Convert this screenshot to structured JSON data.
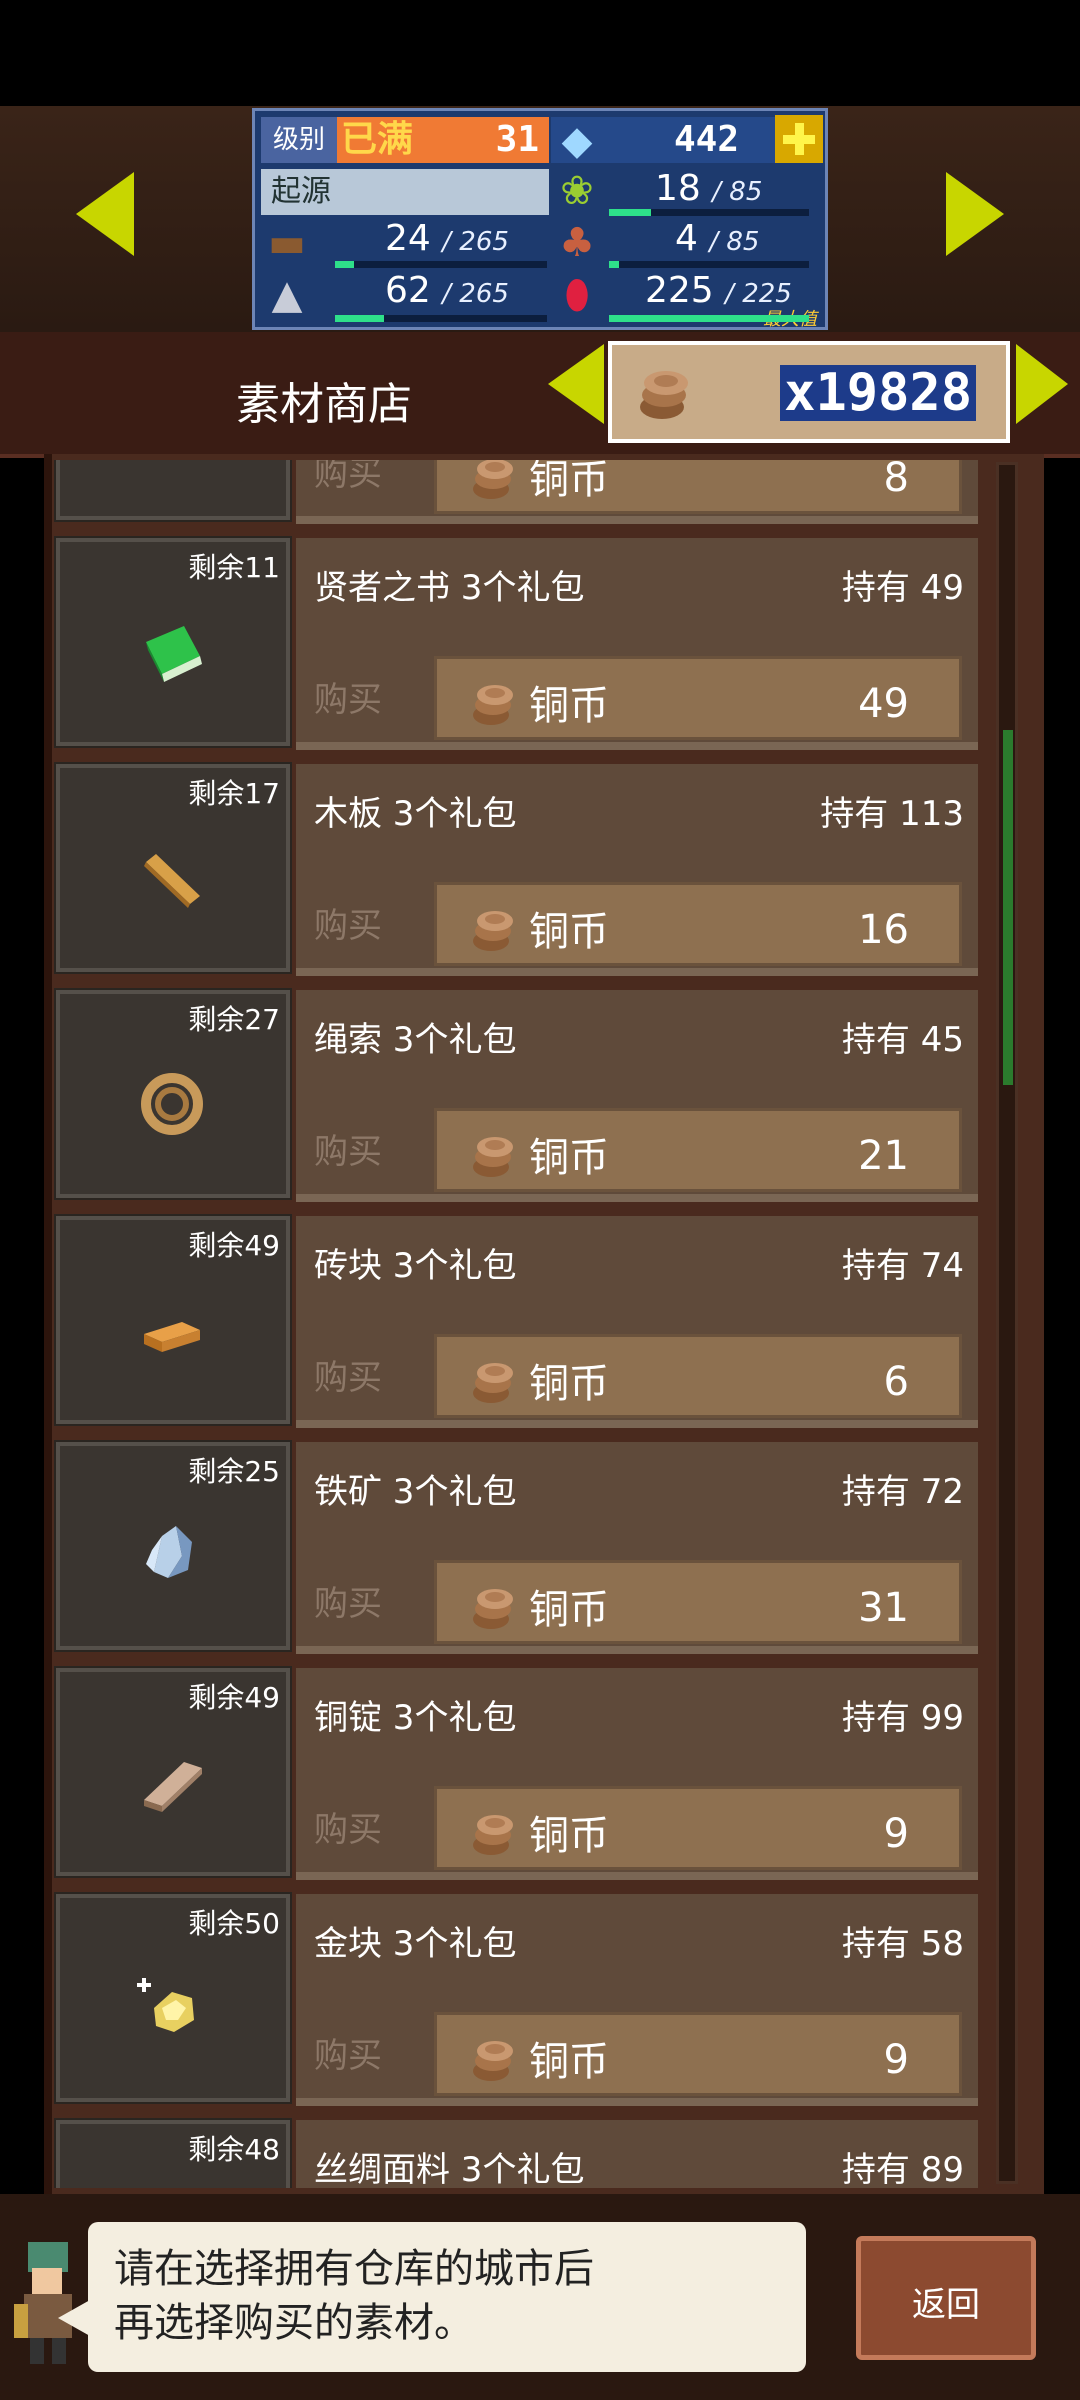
{
  "hud": {
    "level_label": "级别",
    "level_status": "已满",
    "level": "31",
    "gems": "442",
    "origin": "起源",
    "rows": [
      {
        "left_val": "24",
        "left_max": "265",
        "left_fill": 0.09,
        "right_val": "18",
        "right_max": "85",
        "right_fill": 0.21
      },
      {
        "left_val": "4",
        "left_max": "85",
        "left_fill": 0.05
      },
      {
        "left_val": "62",
        "left_max": "265",
        "left_fill": 0.23,
        "right_val": "225",
        "right_max": "225",
        "right_fill": 1.0,
        "right_max_label": "最大值"
      }
    ]
  },
  "shop": {
    "title": "素材商店",
    "coin_count": "x19828"
  },
  "list": {
    "buy_label": "购买",
    "currency": "铜币",
    "items": [
      {
        "remain": "",
        "name": "",
        "own": "",
        "price": "8",
        "icon": "partial-icon"
      },
      {
        "remain": "剩余11",
        "name": "贤者之书 3个礼包",
        "own": "持有 49",
        "price": "49",
        "icon": "green-book-icon"
      },
      {
        "remain": "剩余17",
        "name": "木板 3个礼包",
        "own": "持有 113",
        "price": "16",
        "icon": "wood-plank-icon"
      },
      {
        "remain": "剩余27",
        "name": "绳索 3个礼包",
        "own": "持有 45",
        "price": "21",
        "icon": "rope-icon"
      },
      {
        "remain": "剩余49",
        "name": "砖块 3个礼包",
        "own": "持有 74",
        "price": "6",
        "icon": "brick-icon"
      },
      {
        "remain": "剩余25",
        "name": "铁矿 3个礼包",
        "own": "持有 72",
        "price": "31",
        "icon": "iron-ore-icon"
      },
      {
        "remain": "剩余49",
        "name": "铜锭 3个礼包",
        "own": "持有 99",
        "price": "9",
        "icon": "copper-ingot-icon"
      },
      {
        "remain": "剩余50",
        "name": "金块 3个礼包",
        "own": "持有 58",
        "price": "9",
        "icon": "gold-nugget-icon"
      },
      {
        "remain": "剩余48",
        "name": "丝绸面料 3个礼包",
        "own": "持有 89",
        "price": "",
        "icon": "silk-icon"
      }
    ]
  },
  "footer": {
    "message_line1": "请在选择拥有仓库的城市后",
    "message_line2": "再选择购买的素材。",
    "back_label": "返回"
  }
}
